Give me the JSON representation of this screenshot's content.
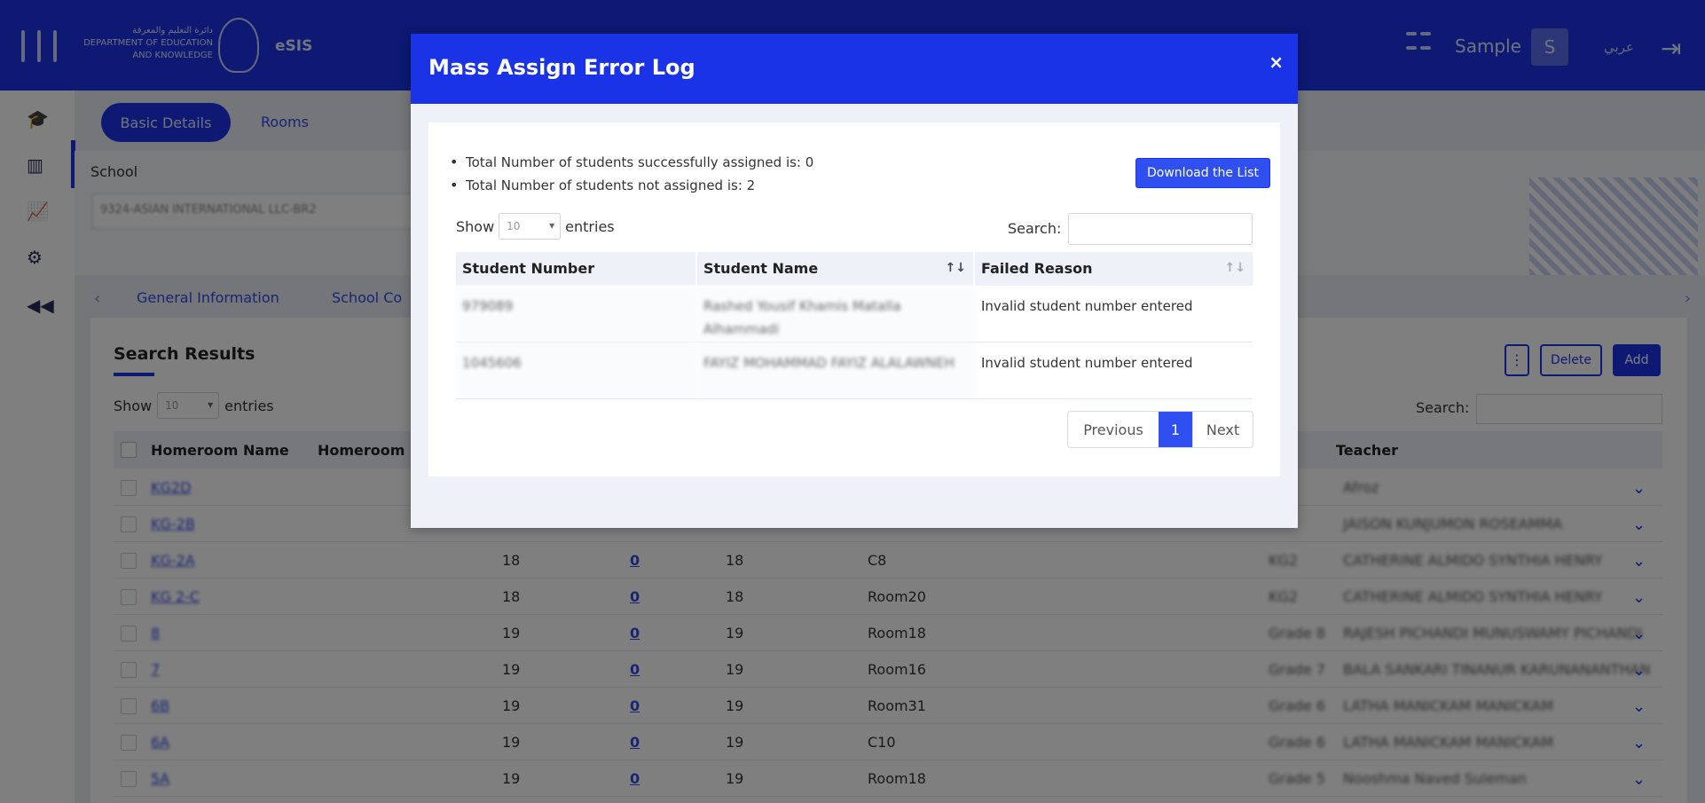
{
  "app": {
    "logo_text_ar": "دائرة التعليم والمعرفة",
    "logo_text_en1": "DEPARTMENT OF EDUCATION",
    "logo_text_en2": "AND KNOWLEDGE",
    "name": "eSIS",
    "user_name": "Sample",
    "avatar_initial": "S",
    "language_toggle": "عربي"
  },
  "sidebar": {
    "icons": [
      "graduation-cap-icon",
      "building-icon",
      "chart-icon",
      "gear-icon",
      "rewind-icon"
    ]
  },
  "page": {
    "tabs": {
      "basic_details": "Basic Details",
      "rooms": "Rooms"
    },
    "school_label": "School",
    "school_value": "9324-ASIAN INTERNATIONAL LLC-BR2",
    "subtabs": [
      "General Information",
      "School Co"
    ],
    "results": {
      "title": "Search Results",
      "show_label": "Show",
      "show_value": "10",
      "entries_label": "entries",
      "search_label": "Search:",
      "kebab_label": "⋮",
      "delete_label": "Delete",
      "add_label": "Add",
      "columns": [
        "Homeroom Name",
        "Homeroom",
        "Teacher"
      ],
      "rows": [
        {
          "name": "KG2D",
          "c1": "",
          "c2": "",
          "c3": "",
          "room": "",
          "grade": "",
          "teacher": "Afroz"
        },
        {
          "name": "KG-2B",
          "c1": "",
          "c2": "",
          "c3": "",
          "room": "",
          "grade": "",
          "teacher": "JAISON KUNJUMON ROSEAMMA"
        },
        {
          "name": "KG-2A",
          "c1": "18",
          "c2": "0",
          "c3": "18",
          "room": "C8",
          "grade": "KG2",
          "teacher": "CATHERINE ALMIDO SYNTHIA HENRY"
        },
        {
          "name": "KG 2-C",
          "c1": "18",
          "c2": "0",
          "c3": "18",
          "room": "Room20",
          "grade": "KG2",
          "teacher": "CATHERINE ALMIDO SYNTHIA HENRY"
        },
        {
          "name": "8",
          "c1": "19",
          "c2": "0",
          "c3": "19",
          "room": "Room18",
          "grade": "Grade 8",
          "teacher": "RAJESH PICHANDI MUNUSWAMY PICHANDI"
        },
        {
          "name": "7",
          "c1": "19",
          "c2": "0",
          "c3": "19",
          "room": "Room16",
          "grade": "Grade 7",
          "teacher": "BALA SANKARI TINANUR KARUNANANTHAN"
        },
        {
          "name": "6B",
          "c1": "19",
          "c2": "0",
          "c3": "19",
          "room": "Room31",
          "grade": "Grade 6",
          "teacher": "LATHA MANICKAM MANICKAM"
        },
        {
          "name": "6A",
          "c1": "19",
          "c2": "0",
          "c3": "19",
          "room": "C10",
          "grade": "Grade 6",
          "teacher": "LATHA MANICKAM MANICKAM"
        },
        {
          "name": "5A",
          "c1": "19",
          "c2": "0",
          "c3": "19",
          "room": "Room18",
          "grade": "Grade 5",
          "teacher": "Nooshma Naved Suleman"
        }
      ]
    }
  },
  "modal": {
    "title": "Mass Assign Error Log",
    "close_label": "×",
    "summary": [
      "Total Number of students successfully assigned is: 0",
      "Total Number of students not assigned is: 2"
    ],
    "download_label": "Download the List",
    "show_label": "Show",
    "show_value": "10",
    "entries_label": "entries",
    "search_label": "Search:",
    "search_value": "",
    "columns": [
      "Student Number",
      "Student Name",
      "Failed Reason"
    ],
    "rows": [
      {
        "number": "979089",
        "name": "Rashed Yousif Khamis Matalla Alhammadi",
        "reason": "Invalid student number entered"
      },
      {
        "number": "1045606",
        "name": "FAYIZ MOHAMMAD FAYIZ ALALAWNEH",
        "reason": "Invalid student number entered"
      }
    ],
    "pagination": {
      "previous": "Previous",
      "current": "1",
      "next": "Next"
    }
  },
  "colors": {
    "brand_blue": "#1a33e6",
    "button_blue": "#2f4ff0",
    "overlay": "rgba(0,0,0,0.5)"
  }
}
